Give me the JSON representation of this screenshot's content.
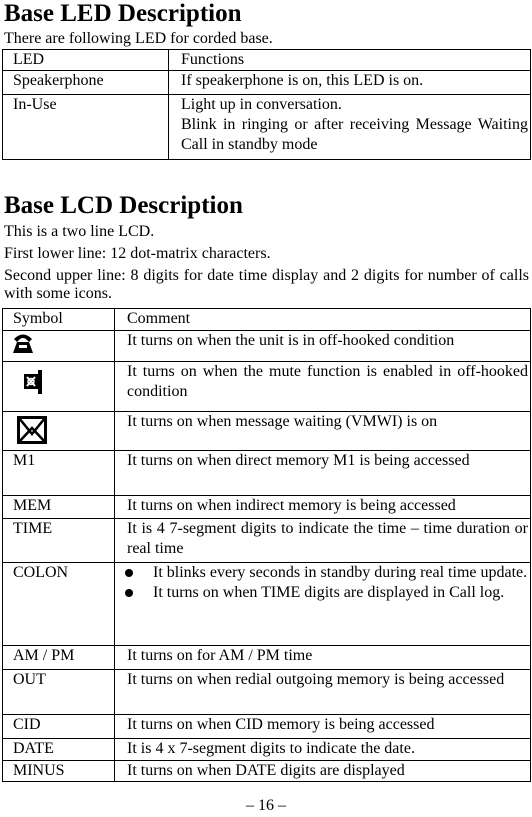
{
  "led_section": {
    "title": "Base LED Description",
    "intro": "There are following LED for corded base.",
    "headers": [
      "LED",
      "Functions"
    ],
    "rows": [
      {
        "led": "Speakerphone",
        "function_lines": [
          "If speakerphone is on, this LED is on."
        ]
      },
      {
        "led": "In-Use",
        "function_lines": [
          "Light up in conversation.",
          "Blink in ringing or after receiving Message Waiting Call in standby mode"
        ]
      }
    ]
  },
  "lcd_section": {
    "title": "Base LCD Description",
    "lines": [
      "This is a two line LCD.",
      "First lower line: 12 dot-matrix characters.",
      "Second upper line: 8 digits for date time display and 2 digits for number of calls with some icons."
    ],
    "headers": [
      "Symbol",
      "Comment"
    ],
    "icon_rows": [
      {
        "icon": "off-hook-phone-icon",
        "comment": "It turns on when the unit is in off-hooked condition"
      },
      {
        "icon": "mute-icon",
        "comment": "It turns on when the mute function is enabled in off-hooked condition"
      },
      {
        "icon": "envelope-icon",
        "comment": "It turns on when message waiting (VMWI) is on"
      }
    ],
    "rows": [
      {
        "symbol": "M1",
        "comment": "It turns on when direct memory M1 is being accessed"
      },
      {
        "symbol": "MEM",
        "comment": "It turns on when indirect memory is being accessed"
      },
      {
        "symbol": "TIME",
        "comment": "It is 4 7-segment digits to indicate the time – time duration or real time"
      }
    ],
    "colon_row": {
      "symbol": "COLON",
      "bullets": [
        "It blinks every seconds in standby during real time update.",
        "It turns on when TIME digits are displayed in Call log."
      ]
    },
    "rows_after": [
      {
        "symbol": "AM / PM",
        "comment": "It turns on for AM / PM time"
      },
      {
        "symbol": "OUT",
        "comment": "It turns on when redial outgoing memory is being accessed"
      },
      {
        "symbol": "CID",
        "comment": "It turns on when CID memory is being accessed"
      },
      {
        "symbol": "DATE",
        "comment": "It is 4 x 7-segment digits to indicate the date."
      },
      {
        "symbol": "MINUS",
        "comment": "It turns on when DATE digits are displayed"
      }
    ]
  },
  "footer": {
    "page_number": "– 16 –"
  }
}
